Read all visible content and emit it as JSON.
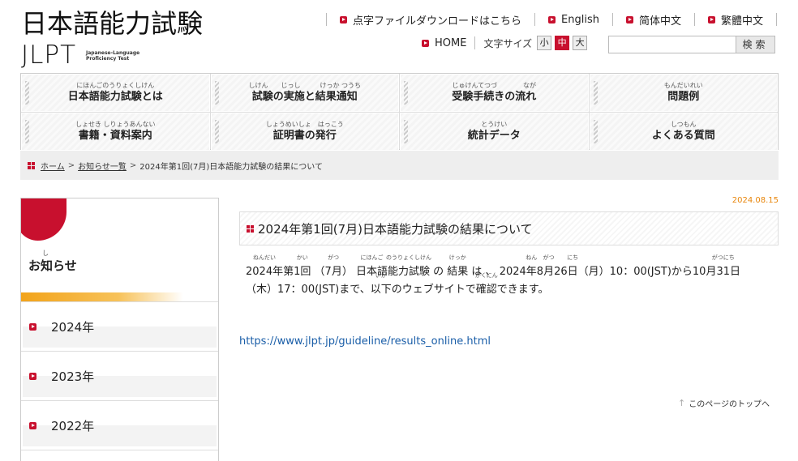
{
  "logo": {
    "kanji": "日本語能力試験",
    "jlpt": "JLPT",
    "subtitle": "Japanese-Language Proficiency Test"
  },
  "topnav": [
    {
      "label": "点字ファイルダウンロードはこちら"
    },
    {
      "label": "English"
    },
    {
      "label": "简体中文"
    },
    {
      "label": "繁體中文"
    }
  ],
  "subnav": {
    "home": "HOME",
    "font_size_label": "文字サイズ",
    "font_sizes": [
      "小",
      "中",
      "大"
    ],
    "font_size_selected": "中",
    "search_placeholder": "",
    "search_button": "検索"
  },
  "menu": [
    {
      "ruby": "にほんごのうりょくしけん",
      "label": "日本語能力試験とは"
    },
    {
      "ruby": "しけん　　じっし　　　けっか つうち",
      "label": "試験の実施と結果通知"
    },
    {
      "ruby": "じゅけんてつづ　　　　なが",
      "label": "受験手続きの流れ"
    },
    {
      "ruby": "もんだいれい",
      "label": "問題例"
    },
    {
      "ruby": "しょせき しりょうあんない",
      "label": "書籍・資料案内"
    },
    {
      "ruby": "しょうめいしょ　はっこう",
      "label": "証明書の発行"
    },
    {
      "ruby": "とうけい",
      "label": "統計データ"
    },
    {
      "ruby": "しつもん",
      "label": "よくある質問"
    }
  ],
  "breadcrumb": {
    "home": "ホーム",
    "list": "お知らせ一覧",
    "current": "2024年第1回(7月)日本語能力試験の結果について",
    "sep": ">"
  },
  "sidebar": {
    "title_ruby": "し",
    "title": "お知らせ",
    "items": [
      {
        "label": "2024年"
      },
      {
        "label": "2023年"
      },
      {
        "label": "2022年"
      }
    ]
  },
  "article": {
    "date": "2024.08.15",
    "title": "2024年第1回(7月)日本語能力試験の結果について",
    "body": {
      "p1": "2024年",
      "p1_ruby": "ねんだい",
      "p2": "第",
      "p3": "1回",
      "p3_ruby": "かい",
      "p4": "（",
      "p5": "7月",
      "p5_ruby": "がつ",
      "p6": "）",
      "p7": "日本語",
      "p7_ruby": "にほんご",
      "p8": "能力試験",
      "p8_ruby": "のうりょくしけん",
      "p9": " の ",
      "p10": "結果",
      "p10_ruby": "けっか",
      "p11": " は 、 2024",
      "p12": "年",
      "p12_ruby": "ねん",
      "p13": "8",
      "p14": "月",
      "p14_ruby": "がつ",
      "p15": "26",
      "p16": "日",
      "p16_ruby": "にち",
      "p17": "（月）10：00(JST)から10",
      "p18": "月31日",
      "p18_ruby": "がつにち",
      "line2a": "（木）17：00(JST)まで、",
      "line2b": "以下",
      "line2b_ruby": "いか",
      "line2c": "のウェブサイトで",
      "line2d": "確認",
      "line2d_ruby": "かくにん",
      "line2e": "できます。"
    },
    "link": "https://www.jlpt.jp/guideline/results_online.html",
    "pagetop": "このページのトップへ"
  },
  "colors": {
    "brand_red": "#c8102e",
    "date_orange": "#e8860c",
    "link_blue": "#1a5ea8",
    "stripe_orange": "#f2a31a"
  }
}
